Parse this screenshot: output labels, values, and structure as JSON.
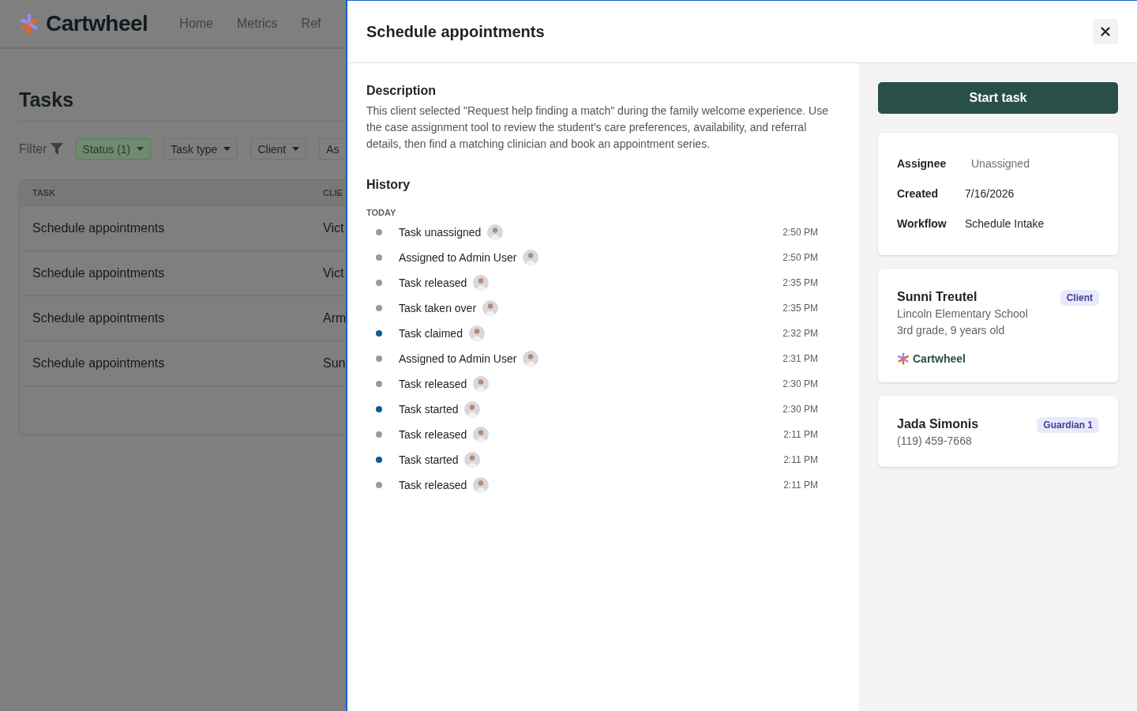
{
  "background": {
    "logo": "Cartwheel",
    "nav": [
      "Home",
      "Metrics",
      "Ref"
    ],
    "title": "Tasks",
    "filter_label": "Filter",
    "filters": [
      {
        "label": "Status (1)",
        "selected": true
      },
      {
        "label": "Task type",
        "selected": false
      },
      {
        "label": "Client",
        "selected": false
      },
      {
        "label": "As",
        "selected": false
      }
    ],
    "table": {
      "columns": [
        "TASK",
        "CLIE"
      ],
      "rows": [
        [
          "Schedule appointments",
          "Vict"
        ],
        [
          "Schedule appointments",
          "Vict"
        ],
        [
          "Schedule appointments",
          "Arm"
        ],
        [
          "Schedule appointments",
          "Sun"
        ]
      ]
    }
  },
  "drawer": {
    "title": "Schedule appointments",
    "description_heading": "Description",
    "description": "This client selected \"Request help finding a match\" during the family welcome experience. Use the case assignment tool to review the student's care preferences, availability, and referral details, then find a matching clinician and book an appointment series.",
    "history_heading": "History",
    "history_group": "TODAY",
    "history": [
      {
        "label": "Task unassigned",
        "time": "2:50 PM",
        "color": "#9a9a9a"
      },
      {
        "label": "Assigned to Admin User",
        "time": "2:50 PM",
        "color": "#9a9a9a"
      },
      {
        "label": "Task released",
        "time": "2:35 PM",
        "color": "#9a9a9a"
      },
      {
        "label": "Task taken over",
        "time": "2:35 PM",
        "color": "#9a9a9a"
      },
      {
        "label": "Task claimed",
        "time": "2:32 PM",
        "color": "#0b5c94"
      },
      {
        "label": "Assigned to Admin User",
        "time": "2:31 PM",
        "color": "#9a9a9a"
      },
      {
        "label": "Task released",
        "time": "2:30 PM",
        "color": "#9a9a9a"
      },
      {
        "label": "Task started",
        "time": "2:30 PM",
        "color": "#0b5c94"
      },
      {
        "label": "Task released",
        "time": "2:11 PM",
        "color": "#9a9a9a"
      },
      {
        "label": "Task started",
        "time": "2:11 PM",
        "color": "#0b5c94"
      },
      {
        "label": "Task released",
        "time": "2:11 PM",
        "color": "#9a9a9a"
      }
    ],
    "start_button": "Start task",
    "details": [
      {
        "label": "Assignee",
        "value": "Unassigned",
        "muted": true
      },
      {
        "label": "Created",
        "value": "7/16/2026",
        "muted": false
      },
      {
        "label": "Workflow",
        "value": "Schedule Intake",
        "muted": false
      }
    ],
    "people": [
      {
        "name": "Sunni Treutel",
        "badge": "Client",
        "lines": [
          "Lincoln Elementary School",
          "3rd grade, 9 years old"
        ],
        "brand": "Cartwheel"
      },
      {
        "name": "Jada Simonis",
        "badge": "Guardian 1",
        "lines": [
          "(119) 459-7668"
        ]
      }
    ]
  }
}
